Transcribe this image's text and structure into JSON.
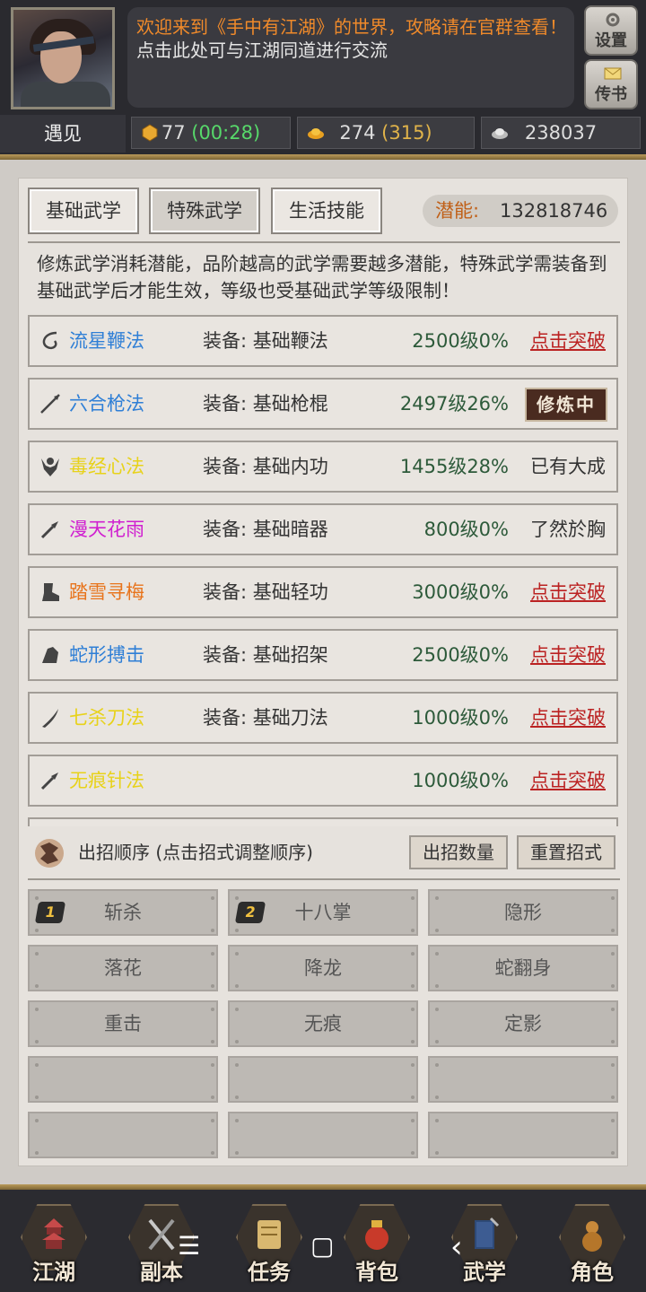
{
  "header": {
    "welcome": "欢迎来到《手中有江湖》的世界，攻略请在官群查看！",
    "chat_hint": "点击此处可与江湖同道进行交流",
    "settings_label": "设置",
    "mail_label": "传书"
  },
  "resources": {
    "meet_label": "遇见",
    "stamina_value": "77",
    "stamina_timer": "(00:28)",
    "gold_value": "274",
    "gold_bonus": "(315)",
    "silver_value": "238037"
  },
  "tabs": [
    {
      "label": "基础武学"
    },
    {
      "label": "特殊武学"
    },
    {
      "label": "生活技能"
    }
  ],
  "potential": {
    "label": "潜能:",
    "value": "132818746"
  },
  "description": "修炼武学消耗潜能，品阶越高的武学需要越多潜能，特殊武学需装备到基础武学后才能生效，等级也受基础武学等级限制！",
  "skills": [
    {
      "name": "流星鞭法",
      "color": "#2f7fd6",
      "equip": "装备: 基础鞭法",
      "level": "2500级0%",
      "action": "点击突破"
    },
    {
      "name": "六合枪法",
      "color": "#2f7fd6",
      "equip": "装备: 基础枪棍",
      "level": "2497级26%",
      "action": "修炼中"
    },
    {
      "name": "毒经心法",
      "color": "#e8d21a",
      "equip": "装备: 基础内功",
      "level": "1455级28%",
      "action": "已有大成"
    },
    {
      "name": "漫天花雨",
      "color": "#d01fd0",
      "equip": "装备: 基础暗器",
      "level": "800级0%",
      "action": "了然於胸"
    },
    {
      "name": "踏雪寻梅",
      "color": "#e8741c",
      "equip": "装备: 基础轻功",
      "level": "3000级0%",
      "action": "点击突破"
    },
    {
      "name": "蛇形搏击",
      "color": "#2f7fd6",
      "equip": "装备: 基础招架",
      "level": "2500级0%",
      "action": "点击突破"
    },
    {
      "name": "七杀刀法",
      "color": "#e8d21a",
      "equip": "装备: 基础刀法",
      "level": "1000级0%",
      "action": "点击突破"
    },
    {
      "name": "无痕针法",
      "color": "#e8d21a",
      "equip": "",
      "level": "1000级0%",
      "action": "点击突破"
    }
  ],
  "moves": {
    "title": "出招顺序 (点击招式调整顺序)",
    "count_btn": "出招数量",
    "reset_btn": "重置招式",
    "slots": [
      {
        "label": "斩杀",
        "badge": "1"
      },
      {
        "label": "十八掌",
        "badge": "2"
      },
      {
        "label": "隐形",
        "badge": ""
      },
      {
        "label": "落花",
        "badge": ""
      },
      {
        "label": "降龙",
        "badge": ""
      },
      {
        "label": "蛇翻身",
        "badge": ""
      },
      {
        "label": "重击",
        "badge": ""
      },
      {
        "label": "无痕",
        "badge": ""
      },
      {
        "label": "定影",
        "badge": ""
      },
      {
        "label": "",
        "badge": ""
      },
      {
        "label": "",
        "badge": ""
      },
      {
        "label": "",
        "badge": ""
      },
      {
        "label": "",
        "badge": ""
      },
      {
        "label": "",
        "badge": ""
      },
      {
        "label": "",
        "badge": ""
      }
    ]
  },
  "bottom_nav": [
    {
      "label": "江湖",
      "icon": "pagoda-icon"
    },
    {
      "label": "副本",
      "icon": "crossed-swords-icon"
    },
    {
      "label": "任务",
      "icon": "scroll-icon"
    },
    {
      "label": "背包",
      "icon": "pouch-icon"
    },
    {
      "label": "武学",
      "icon": "book-icon"
    },
    {
      "label": "角色",
      "icon": "gourd-icon"
    }
  ],
  "system_nav": {
    "menu": "☰",
    "home": "▢",
    "back": "‹"
  }
}
